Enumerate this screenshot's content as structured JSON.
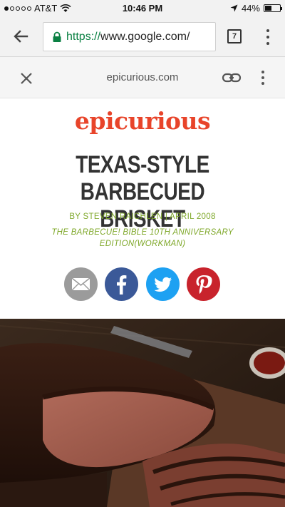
{
  "status_bar": {
    "carrier": "AT&T",
    "time": "10:46 PM",
    "battery": "44%",
    "battery_level": 0.44
  },
  "browser": {
    "url_scheme": "https://",
    "url_host": "www.google.com/",
    "tab_count": "7"
  },
  "amp_viewer": {
    "domain": "epicurious.com"
  },
  "article": {
    "logo": "epicurious",
    "title": "Texas-Style Barbecued Brisket",
    "byline": "BY STEVEN RAICHLEN | APRIL 2008",
    "source": "The Barbecue! Bible 10th Anniversary Edition(Workman)"
  },
  "share": {
    "icons": [
      "email-icon",
      "facebook-icon",
      "twitter-icon",
      "pinterest-icon"
    ]
  },
  "colors": {
    "brand": "#e8442a",
    "byline": "#7fa82a",
    "url_secure": "#0b8043",
    "facebook": "#3b5998",
    "twitter": "#1da1f2",
    "pinterest": "#c8232c"
  }
}
